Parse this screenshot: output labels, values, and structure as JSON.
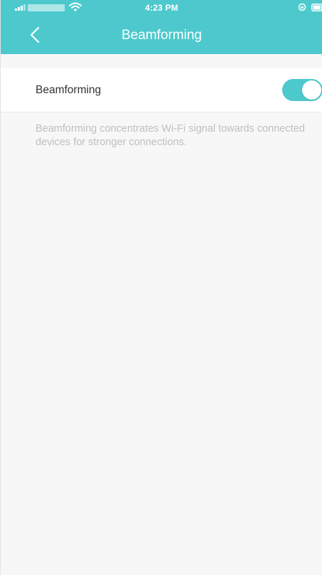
{
  "status_bar": {
    "time": "4:23 PM"
  },
  "nav": {
    "title": "Beamforming",
    "back_icon": "chevron-left-icon"
  },
  "setting": {
    "label": "Beamforming",
    "enabled": true
  },
  "description": "Beamforming concentrates Wi-Fi signal towards connected devices for stronger connections.",
  "colors": {
    "accent": "#4dc9cd",
    "background": "#f7f7f7",
    "label_text": "#333333",
    "description_text": "#bfbfbf"
  }
}
